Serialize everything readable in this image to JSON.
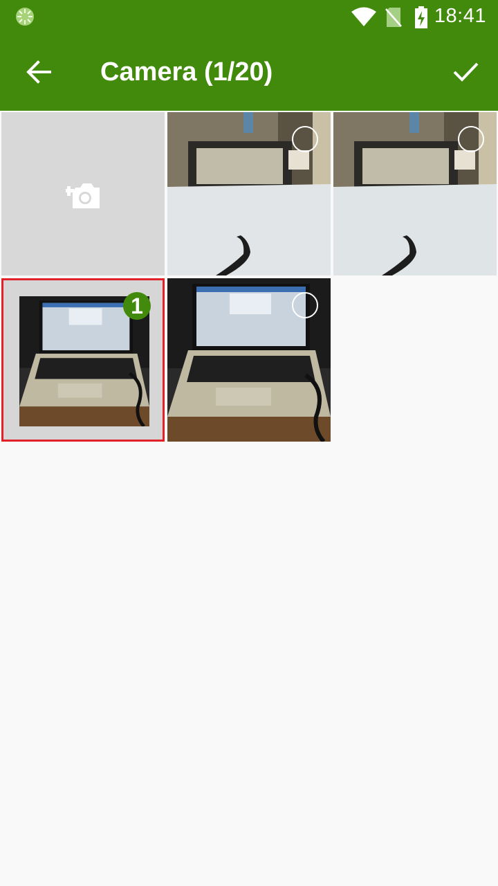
{
  "status_bar": {
    "time": "18:41"
  },
  "app_bar": {
    "title": "Camera (1/20)"
  },
  "grid": {
    "selected_badge": "1"
  },
  "colors": {
    "accent": "#428a0b",
    "selection_border": "#e2202a",
    "background": "#f9f9f9"
  }
}
